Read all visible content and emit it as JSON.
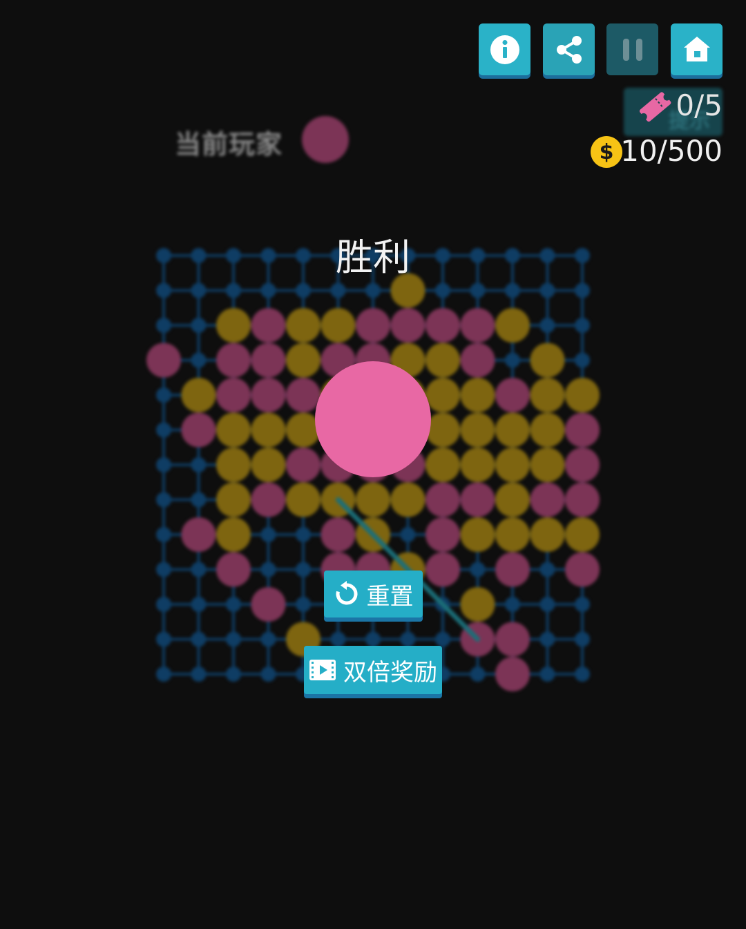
{
  "header": {
    "tickets_text": "0/5",
    "ticket_button_label": "提示",
    "coins_text": "10/500",
    "coin_symbol": "$"
  },
  "status": {
    "current_player_label": "当前玩家",
    "current_player_color": "#7c3456"
  },
  "result": {
    "title": "胜利",
    "winning_piece_color": "#e868a4"
  },
  "buttons": {
    "reset_label": "重置",
    "double_reward_label": "双倍奖励"
  },
  "colors": {
    "background": "#0e0e0e",
    "grid": "#0f3d64",
    "player_pink": "#7c3456",
    "player_gold": "#7e6510",
    "win_line": "#1b6e78",
    "accent_button": "#25aec7"
  },
  "board": {
    "size": 13,
    "rows": [
      ".............",
      ".......G.....",
      "..GPGGPPPPG..",
      "P.PPGPPGGP.G.",
      ".GPPPGPGGGPGG",
      ".PGGGG.GGGGGP",
      "..GGPPPPGGGGP",
      "..GPGGGGPPGPP",
      ".PG..PG.PGGGG",
      "..P..PPGP.P.P",
      "...P.....G...",
      "....G....PP..",
      "..........P.."
    ],
    "win_line": {
      "from": [
        7,
        5
      ],
      "to": [
        11,
        9
      ]
    }
  }
}
